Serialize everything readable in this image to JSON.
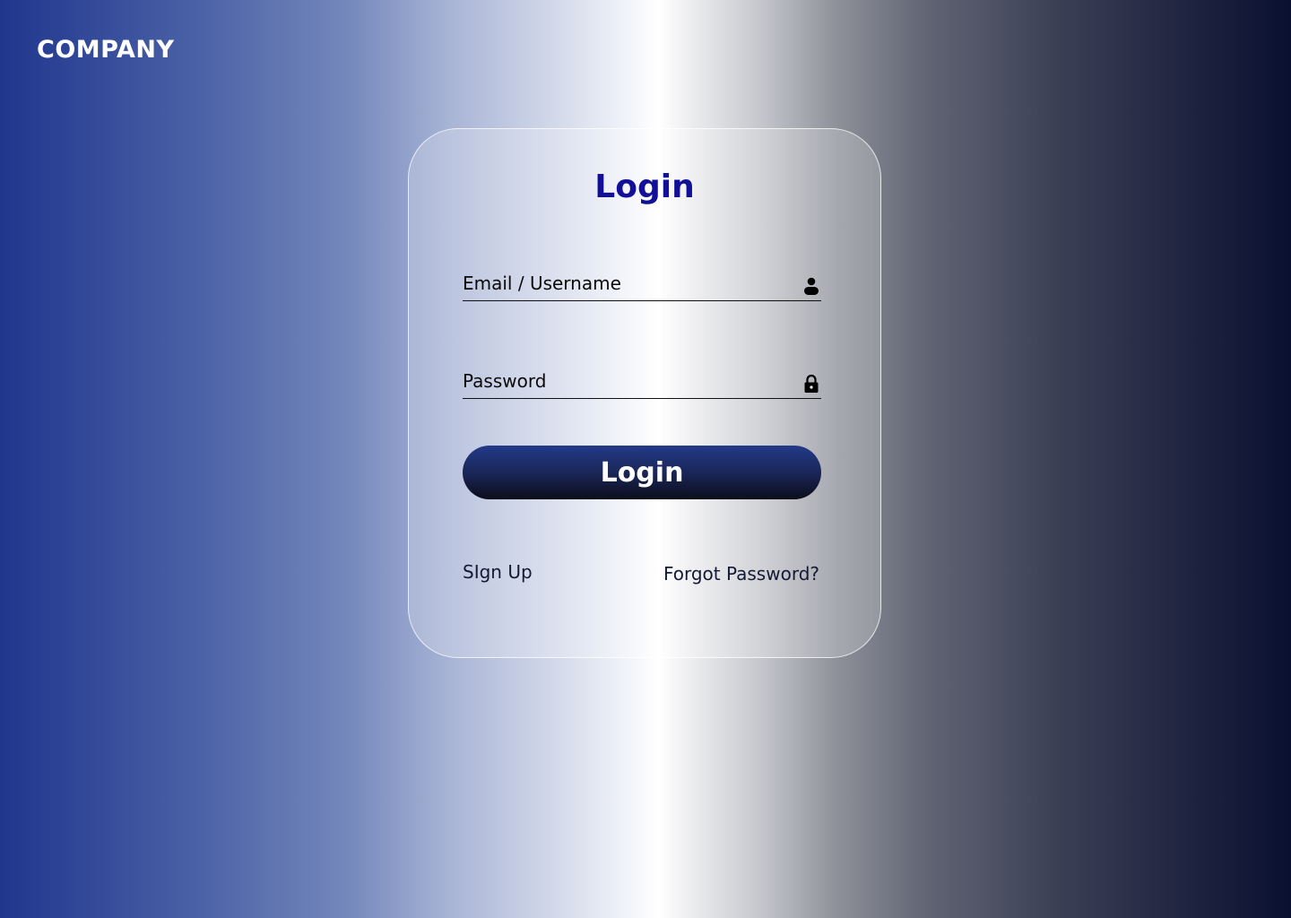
{
  "brand": {
    "logo_text": "COMPANY"
  },
  "login_card": {
    "title": "Login",
    "email_field": {
      "label": "Email / Username",
      "icon": "user-icon"
    },
    "password_field": {
      "label": "Password",
      "icon": "lock-icon"
    },
    "submit_label": "Login",
    "signup_link": "SIgn Up",
    "forgot_link": "Forgot Password?"
  },
  "colors": {
    "title": "#120f98",
    "button_top": "#233a8a",
    "button_bottom": "#0c0e1a",
    "background_left": "#1f368d",
    "background_right": "#0a1030"
  }
}
